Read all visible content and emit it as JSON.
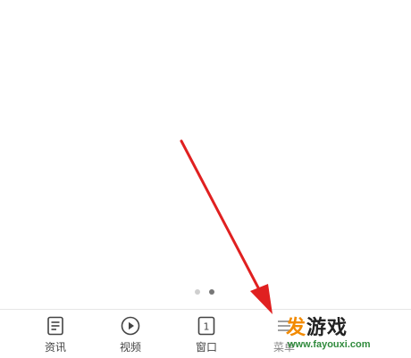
{
  "page_indicator": {
    "count": 2,
    "active": 2
  },
  "tabs": [
    {
      "label": "资讯",
      "icon": "news-icon"
    },
    {
      "label": "视频",
      "icon": "play-circle-icon"
    },
    {
      "label": "窗口",
      "icon": "window-count-icon",
      "badge": "1"
    },
    {
      "label": "菜单",
      "icon": "menu-icon"
    }
  ],
  "watermark": {
    "title_first": "发",
    "title_rest": "游戏",
    "url": "www.fayouxi.com"
  },
  "colors": {
    "arrow": "#e02020",
    "watermark_orange": "#f28a00",
    "watermark_green": "#2f8a3c"
  }
}
